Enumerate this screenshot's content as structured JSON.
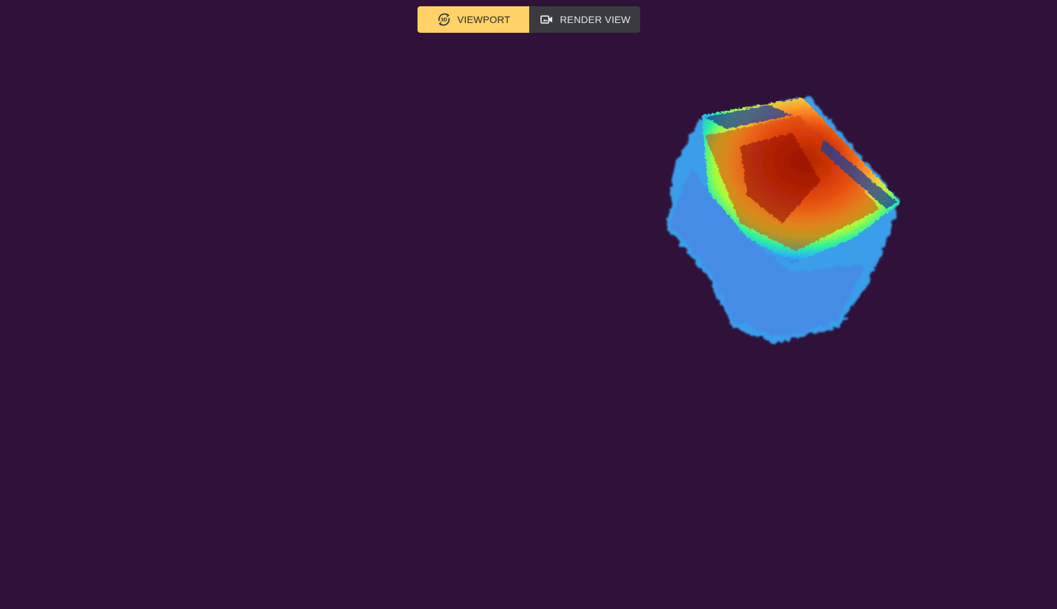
{
  "toolbar": {
    "viewport_label": "VIEWPORT",
    "render_view_label": "RENDER VIEW",
    "viewport_icon": "rotate-3d-icon",
    "render_view_icon": "video-camera-icon",
    "active_mode": "viewport"
  },
  "colors": {
    "background": "#30113a",
    "active_button": "#ffd166",
    "inactive_button": "#3a3b3f"
  },
  "scene": {
    "object": "point-cloud",
    "colormap": "turbo"
  }
}
